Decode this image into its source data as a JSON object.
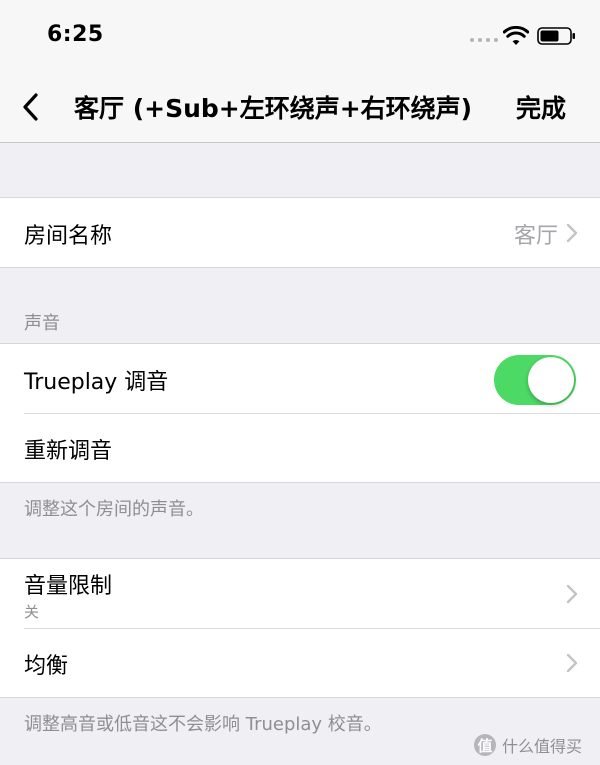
{
  "status_bar": {
    "time": "6:25",
    "icons": [
      "signal-dots-icon",
      "wifi-icon",
      "battery-icon"
    ]
  },
  "nav": {
    "back_icon": "chevron-left-icon",
    "title": "客厅 (+Sub+左环绕声+右环绕声)",
    "done_label": "完成"
  },
  "room": {
    "name_label": "房间名称",
    "name_value": "客厅"
  },
  "sound": {
    "header": "声音",
    "trueplay_label": "Trueplay 调音",
    "trueplay_enabled": true,
    "retune_label": "重新调音",
    "footer": "调整这个房间的声音。"
  },
  "audio": {
    "volume_limit_label": "音量限制",
    "volume_limit_value": "关",
    "eq_label": "均衡",
    "footer": "调整高音或低音这不会影响 Trueplay 校音。"
  },
  "watermark": {
    "badge": "值",
    "text": "什么值得买"
  },
  "colors": {
    "toggle_on": "#4cd964",
    "background": "#efeff4",
    "secondary_text": "#8e8e93"
  }
}
